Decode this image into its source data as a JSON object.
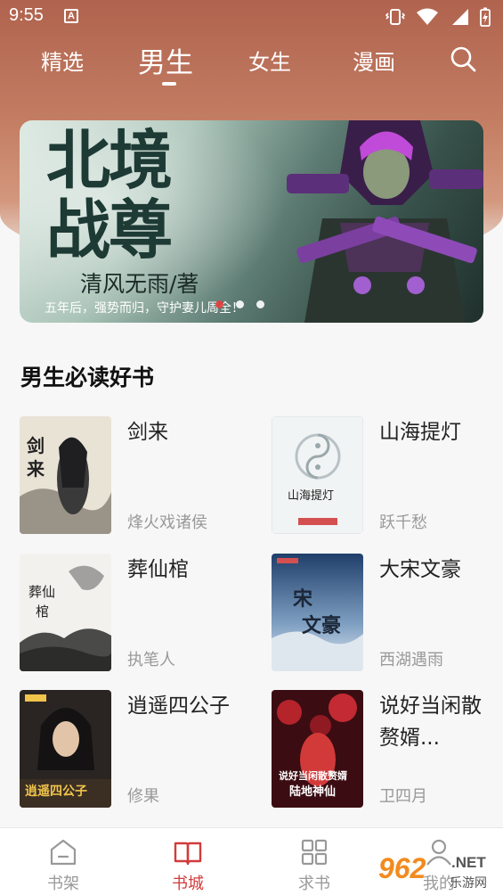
{
  "status_bar": {
    "time": "9:55",
    "notification_letter": "A"
  },
  "top_tabs": [
    {
      "label": "精选",
      "active": false
    },
    {
      "label": "男生",
      "active": true
    },
    {
      "label": "女生",
      "active": false
    },
    {
      "label": "漫画",
      "active": false
    }
  ],
  "banner": {
    "title_line1": "北境",
    "title_line2": "战尊",
    "author": "清风无雨/著",
    "slogan": "五年后，强势而归，守护妻儿周全！",
    "page_count": 3,
    "active_page": 1
  },
  "section": {
    "title": "男生必读好书"
  },
  "books": [
    {
      "name": "剑来",
      "author": "烽火戏诸侯",
      "cover_text": "剑来"
    },
    {
      "name": "山海提灯",
      "author": "跃千愁",
      "cover_text": "山海提灯"
    },
    {
      "name": "葬仙棺",
      "author": "执笔人",
      "cover_text": "葬仙棺"
    },
    {
      "name": "大宋文豪",
      "author": "西湖遇雨",
      "cover_text": "大宋文豪"
    },
    {
      "name": "逍遥四公子",
      "author": "修果",
      "cover_text": "逍遥四公子"
    },
    {
      "name": "说好当闲散赘婿...",
      "author": "卫四月",
      "cover_text": "陆地神仙"
    }
  ],
  "bottom_nav": [
    {
      "label": "书架",
      "icon": "bookshelf-icon",
      "active": false
    },
    {
      "label": "书城",
      "icon": "open-book-icon",
      "active": true
    },
    {
      "label": "求书",
      "icon": "grid-icon",
      "active": false
    },
    {
      "label": "我的",
      "icon": "person-icon",
      "active": false
    }
  ],
  "watermark": {
    "number": "962",
    "net": ".NET",
    "site": "乐游网"
  },
  "colors": {
    "accent": "#d23b3b",
    "header": "#b0634e",
    "muted": "#999999"
  }
}
